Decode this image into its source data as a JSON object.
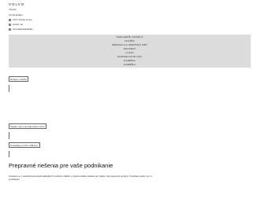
{
  "brand": {
    "logo": "VOLVO",
    "subtitle": "Trucks"
  },
  "country_selector": {
    "title": "Zvoľte krajinu",
    "options": [
      "Volvo Trucks Group",
      "Global | sk",
      "Slovenská Republika"
    ]
  },
  "menu": {
    "items": [
      "NAKLADNÉ VOZIDLÁ",
      "SLUŽBY",
      "PREDAJCA A SERVISNÁ SIEŤ",
      "NOVINKY",
      "O NÁS",
      "KONTAKTUJTE NÁS",
      "KARIÉRA",
      "KARIÉRA"
    ]
  },
  "actions": {
    "find_dealer": "Predajca a služby",
    "find_service": "Nájdite vaše a servisné miesto Volvo",
    "contact": "Kontaktuje sa Volvo FH Aero"
  },
  "main": {
    "heading": "Prepravné riešenia pre vaše podnikanie",
    "paragraph": "Zostanete so v neustálom prostredí nákladných vozidiel a služieb a objavte ideálne riešenie pre všetky vaše prepravné potreby. Ta nájdete pomoc ste, čo potrebujete."
  }
}
